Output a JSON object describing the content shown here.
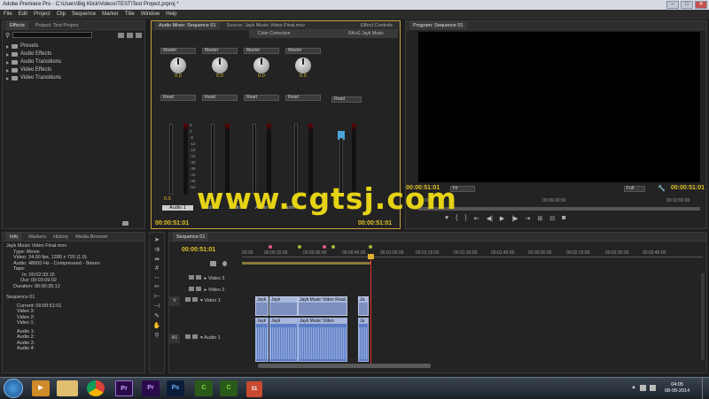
{
  "window": {
    "title": "Adobe Premiere Pro - C:\\Users\\Big Klick\\Videos\\TEST\\Test Project.prproj *"
  },
  "menu": [
    "File",
    "Edit",
    "Project",
    "Clip",
    "Sequence",
    "Marker",
    "Title",
    "Window",
    "Help"
  ],
  "effects_panel": {
    "tabs": [
      "Effects",
      "Project: Test Project"
    ],
    "items": [
      "Presets",
      "Audio Effects",
      "Audio Transitions",
      "Video Effects",
      "Video Transitions"
    ]
  },
  "mixer_panel": {
    "tabs": [
      "Audio Mixer: Sequence 01",
      "Source: Jayk Music Video Final.mov",
      "Effect Controls"
    ],
    "popup_items": [
      "Color Correction",
      "RA+G Jayk Music"
    ],
    "channel_mode": "Master",
    "automation": "Read",
    "knob_value": "0.0",
    "channel_labels": [
      "Audio 1",
      "Audio 2",
      "Audio 3",
      "Audio 4",
      "Master"
    ],
    "scale": [
      "dB",
      "6",
      "0",
      "-6",
      "-12",
      "-18",
      "-24",
      "-30",
      "-36",
      "-42",
      "-48",
      "-54"
    ],
    "timecode": "00:00:51:01"
  },
  "program_monitor": {
    "tab": "Program: Sequence 01",
    "timecode_left": "00:00:51:01",
    "fit": "Fit",
    "timecode_right": "00:00:51:01",
    "quality": "Full",
    "ruler": [
      "00:00",
      "00:05:00:00",
      "00:10:00:00"
    ]
  },
  "info_panel": {
    "tabs": [
      "Info",
      "Markers",
      "History",
      "Media Browser"
    ],
    "lines": [
      "Jayk Music Video Final.mov",
      "Type: Movie",
      "Video: 24.00 fps, 1280 x 720 (1.0)",
      "Audio: 48000 Hz - Compressed - Stereo",
      "Tape:",
      "In: 00:02:33:15",
      "Out: 00:03:09:02",
      "Duration: 00:00:35:12"
    ],
    "sequence": "Sequence 01",
    "seq_lines": [
      "Current: 00:00:51:01",
      "Video 3:",
      "Video 2:",
      "Video 1:",
      "Audio 1:",
      "Audio 2:",
      "Audio 3:",
      "Audio 4:"
    ]
  },
  "timeline": {
    "tab": "Sequence 01",
    "timecode": "00:00:51:01",
    "ruler": [
      "00:00",
      "00:00:15:00",
      "00:00:30:00",
      "00:00:45:00",
      "00:01:00:00",
      "00:01:15:00",
      "00:01:30:00",
      "00:01:45:00",
      "00:02:00:00",
      "00:02:15:00",
      "00:02:30:00",
      "00:02:45:00"
    ],
    "tracks": {
      "video3": "Video 3",
      "video2": "Video 2",
      "video1": "Video 1",
      "audio1": "Audio 1"
    },
    "track_tags": {
      "v": "V",
      "a": "A1"
    },
    "video_clips": [
      "Jayk",
      "Jayk",
      "Jayk Music Video Final.mov [V]",
      "Ja"
    ],
    "audio_clips": [
      "Jayk",
      "Jayk",
      "Jayk Music Video Final.mov [A]",
      "Ja"
    ]
  },
  "taskbar": {
    "apps": [
      "media-player",
      "explorer",
      "chrome",
      "premiere",
      "premiere-2",
      "photoshop",
      "camtasia",
      "camtasia-recorder",
      "calendar"
    ],
    "time": "04:05",
    "date": "08-09-2014"
  },
  "watermark": "www.cgtsj.com"
}
